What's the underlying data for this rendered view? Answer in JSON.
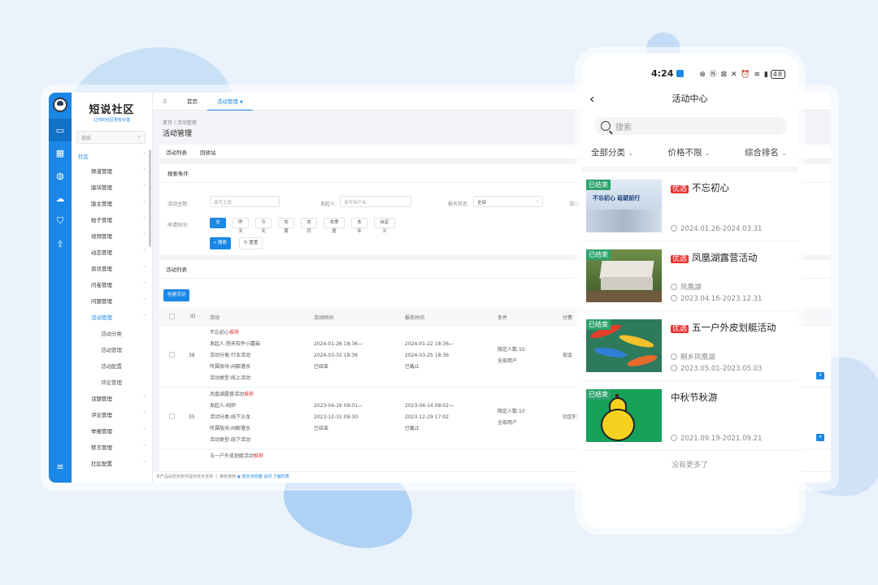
{
  "admin": {
    "logo": "短说社区",
    "logo_sub": "让你的社区更有价值",
    "search_placeholder": "搜索",
    "menu_top": "社区",
    "menu": [
      "频道管理",
      "版块管理",
      "版主管理",
      "帖子管理",
      "视频管理",
      "动态管理",
      "资讯管理",
      "问卷管理",
      "问题管理",
      "活动管理"
    ],
    "submenu": [
      "活动分类",
      "活动管理",
      "活动配置",
      "评论管理"
    ],
    "menu_bottom": [
      "话题管理",
      "评论管理",
      "举报管理",
      "禁言管理",
      "社区配置"
    ],
    "tabs": [
      "首页",
      "活动管理"
    ],
    "breadcrumb": "首页 / 活动管理",
    "page_title": "活动管理",
    "subtabs": [
      "活动列表",
      "回收站"
    ],
    "filter": {
      "title": "搜索条件",
      "topic_label": "活动主题:",
      "topic_placeholder": "填写主题",
      "initiator_label": "发起人:",
      "initiator_placeholder": "填写用户名",
      "status_label": "报名状态",
      "status_value": "全部",
      "extra_label": "活动",
      "time_label": "申请时间:",
      "time_chips": [
        "全部",
        "昨天",
        "今天",
        "本周",
        "本月",
        "本季度",
        "本年",
        "自定义"
      ],
      "search_btn": "搜索",
      "reset_btn": "重置"
    },
    "list": {
      "title": "活动列表",
      "create_btn": "创建活动",
      "headers": [
        "ID",
        "活动",
        "活动时间",
        "报名时间",
        "条件",
        "付费"
      ],
      "rows": [
        {
          "id": "38",
          "name": "不忘初心",
          "tag": "推荐",
          "initiator": "发起人:想天软件小蘑菇",
          "category": "活动分类:行业活动",
          "board": "所属版块:闲聊灌水",
          "type": "活动类型:线上活动",
          "time1": "2024-01-26 18:36—",
          "time2": "2024-03-31 18:36",
          "time3": "已结束",
          "reg1": "2024-01-22 18:36—",
          "reg2": "2024-03-25 18:36",
          "reg3": "已截止",
          "cond1": "限定人数:10",
          "cond2": "全部用户",
          "pay": "现金"
        },
        {
          "id": "35",
          "name": "凤凰湖露营活动",
          "tag": "推荐",
          "initiator": "发起人:纯师",
          "category": "活动分类:线下沙龙",
          "board": "所属版块:闲聊灌水",
          "type": "活动类型:线下活动",
          "time1": "2023-04-16 09:01—",
          "time2": "2023-12-31 09:30",
          "time3": "已结束",
          "reg1": "2023-04-14 09:02—",
          "reg2": "2023-12-29 17:02",
          "reg3": "已截止",
          "cond1": "限定人数:10",
          "cond2": "全部用户",
          "pay": "社区积"
        },
        {
          "id": "",
          "name": "五一户外皮划艇活动",
          "tag": "推荐",
          "initiator": "",
          "category": "",
          "board": "",
          "type": "",
          "time1": "",
          "time2": "",
          "time3": "",
          "reg1": "",
          "reg2": "",
          "reg3": "",
          "cond1": "",
          "cond2": "",
          "pay": ""
        }
      ]
    },
    "footer_text": "本产品由想天软件提供技术支持",
    "footer_recommend": "推荐使用",
    "footer_browser": "想天浏览器",
    "footer_visit": "访问",
    "footer_more": "了解优势"
  },
  "phone": {
    "time": "4:24",
    "battery": "48",
    "title": "活动中心",
    "search_placeholder": "搜索",
    "filters": [
      "全部分类",
      "价格不限",
      "综合排名"
    ],
    "items": [
      {
        "tag": "已结束",
        "badge": "优选",
        "title": "不忘初心",
        "location": "",
        "dates": "2024.01.26-2024.03.31",
        "thumb_text": "不忘初心 砥砺前行"
      },
      {
        "tag": "已结束",
        "badge": "优选",
        "title": "凤凰湖露营活动",
        "location": "凤凰湖",
        "dates": "2023.04.16-2023.12.31"
      },
      {
        "tag": "已结束",
        "badge": "优选",
        "title": "五一户外皮划艇活动",
        "location": "桐乡凤凰湖",
        "dates": "2023.05.01-2023.05.03"
      },
      {
        "tag": "已结束",
        "badge": "",
        "title": "中秋节秋游",
        "location": "",
        "dates": "2021.09.19-2021.09.21"
      }
    ],
    "no_more": "没有更多了"
  },
  "colors": {
    "accent": "#1b87e6",
    "ended_tag": "#2da36d",
    "badge": "#e8322f"
  }
}
